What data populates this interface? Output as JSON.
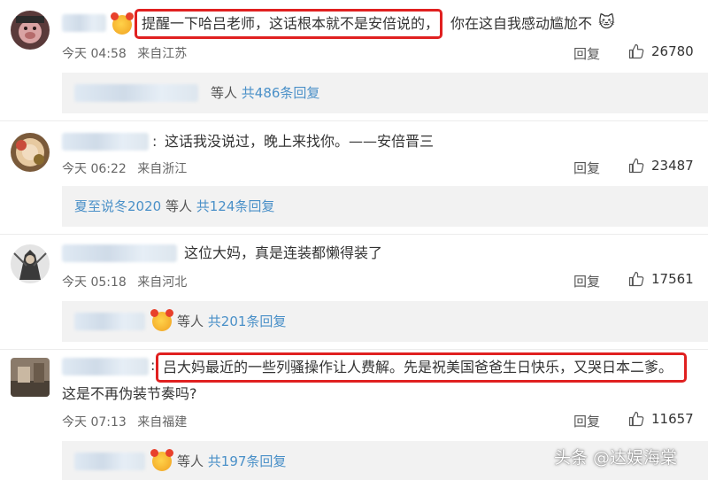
{
  "comments": [
    {
      "text_highlighted": "提醒一下哈吕老师，这话根本就不是安倍说的，",
      "text_rest": "你在这自我感动尴尬不",
      "time": "今天 04:58",
      "location": "来自江苏",
      "reply_label": "回复",
      "likes": "26780",
      "replies": {
        "who": "",
        "mid": "等人",
        "count": "共486条回复"
      }
    },
    {
      "text": "这话我没说过，晚上来找你。——安倍晋三",
      "time": "今天 06:22",
      "location": "来自浙江",
      "reply_label": "回复",
      "likes": "23487",
      "replies": {
        "who": "夏至说冬2020",
        "mid": "等人",
        "count": "共124条回复"
      }
    },
    {
      "text": "这位大妈，真是连装都懒得装了",
      "time": "今天 05:18",
      "location": "来自河北",
      "reply_label": "回复",
      "likes": "17561",
      "replies": {
        "who": "",
        "mid": "等人",
        "count": "共201条回复"
      }
    },
    {
      "text_highlighted": "吕大妈最近的一些列骚操作让人费解。先是祝美国爸爸生日快乐，又哭日本二爹。",
      "text_line2": "这是不再伪装节奏吗?",
      "time": "今天 07:13",
      "location": "来自福建",
      "reply_label": "回复",
      "likes": "11657",
      "replies": {
        "who": "",
        "mid": "等人",
        "count": "共197条回复"
      }
    }
  ],
  "watermark": "头条 @达娱海棠",
  "colors": {
    "link": "#4a90c8",
    "highlight": "#e02020",
    "reply_bg": "#f2f2f2"
  },
  "icons": [
    "thumbs-up-icon",
    "cat-emoji-icon",
    "avatar-image"
  ]
}
